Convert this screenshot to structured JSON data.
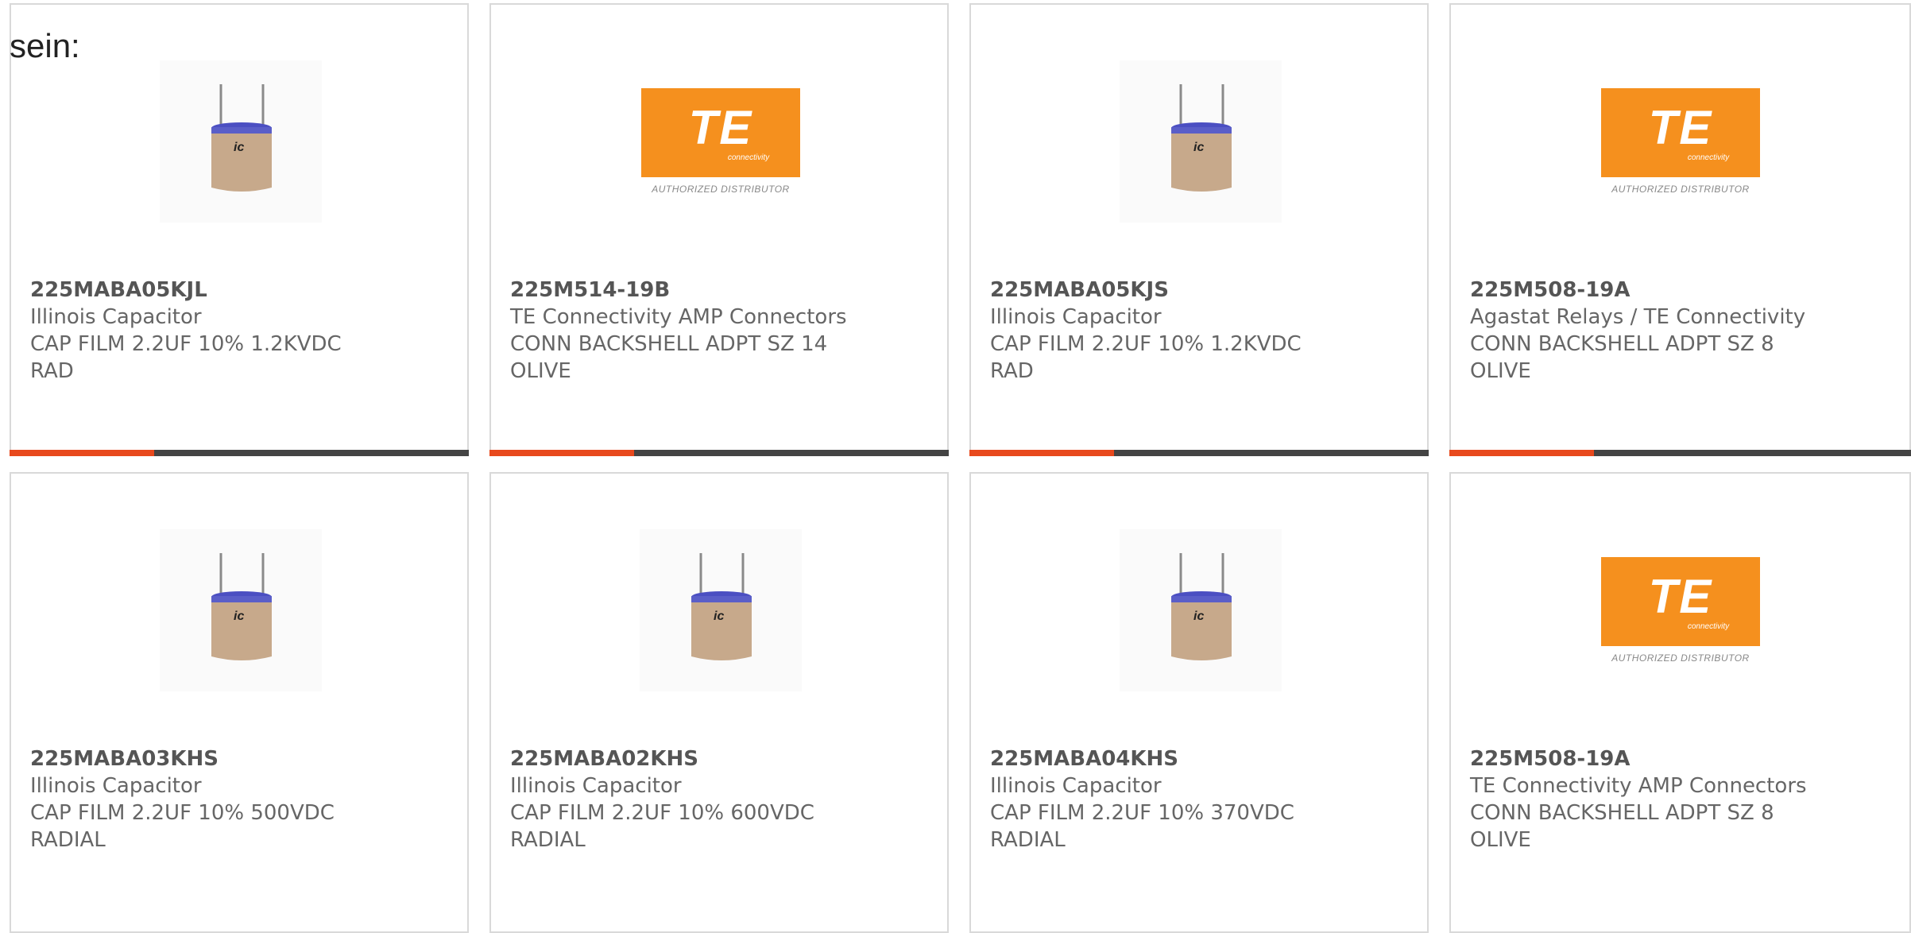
{
  "intro": "sein:",
  "colors": {
    "accent": "#e8491d",
    "accent_dark": "#444444",
    "te_orange": "#f5901e"
  },
  "te_logo": {
    "mark": "TE",
    "sub": "connectivity",
    "note": "AUTHORIZED DISTRIBUTOR"
  },
  "products": [
    {
      "pn": "225MABA05KJL",
      "mfr": "Illinois Capacitor",
      "desc": "CAP FILM 2.2UF 10% 1.2KVDC\nRAD",
      "icon": "capacitor-image"
    },
    {
      "pn": "225M514-19B",
      "mfr": "TE Connectivity AMP Connectors",
      "desc": "CONN BACKSHELL ADPT SZ 14\nOLIVE",
      "icon": "te-logo"
    },
    {
      "pn": "225MABA05KJS",
      "mfr": "Illinois Capacitor",
      "desc": "CAP FILM 2.2UF 10% 1.2KVDC\nRAD",
      "icon": "capacitor-image"
    },
    {
      "pn": "225M508-19A",
      "mfr": "Agastat Relays / TE Connectivity",
      "desc": "CONN BACKSHELL ADPT SZ 8\nOLIVE",
      "icon": "te-logo"
    },
    {
      "pn": "225MABA03KHS",
      "mfr": "Illinois Capacitor",
      "desc": "CAP FILM 2.2UF 10% 500VDC\nRADIAL",
      "icon": "capacitor-image"
    },
    {
      "pn": "225MABA02KHS",
      "mfr": "Illinois Capacitor",
      "desc": "CAP FILM 2.2UF 10% 600VDC\nRADIAL",
      "icon": "capacitor-image"
    },
    {
      "pn": "225MABA04KHS",
      "mfr": "Illinois Capacitor",
      "desc": "CAP FILM 2.2UF 10% 370VDC\nRADIAL",
      "icon": "capacitor-image"
    },
    {
      "pn": "225M508-19A",
      "mfr": "TE Connectivity AMP Connectors",
      "desc": "CONN BACKSHELL ADPT SZ 8\nOLIVE",
      "icon": "te-logo"
    }
  ]
}
